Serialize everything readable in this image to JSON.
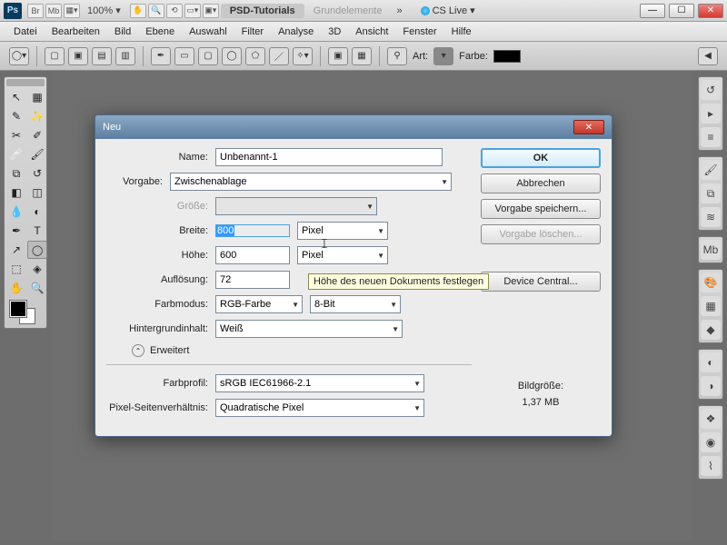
{
  "titlebar": {
    "zoom": "100%",
    "tab_active": "PSD-Tutorials",
    "tab_inactive": "Grundelemente",
    "cs_live": "CS Live"
  },
  "menubar": [
    "Datei",
    "Bearbeiten",
    "Bild",
    "Ebene",
    "Auswahl",
    "Filter",
    "Analyse",
    "3D",
    "Ansicht",
    "Fenster",
    "Hilfe"
  ],
  "optionsbar": {
    "art_label": "Art:",
    "farbe_label": "Farbe:"
  },
  "dialog": {
    "title": "Neu",
    "name_label": "Name:",
    "name_value": "Unbenannt-1",
    "vorgabe_label": "Vorgabe:",
    "vorgabe_value": "Zwischenablage",
    "groesse_label": "Größe:",
    "breite_label": "Breite:",
    "breite_value": "800",
    "breite_unit": "Pixel",
    "hoehe_label": "Höhe:",
    "hoehe_value": "600",
    "hoehe_unit": "Pixel",
    "aufloesung_label": "Auflösung:",
    "aufloesung_value": "72",
    "farbmodus_label": "Farbmodus:",
    "farbmodus_value": "RGB-Farbe",
    "farbmodus_bits": "8-Bit",
    "hintergrund_label": "Hintergrundinhalt:",
    "hintergrund_value": "Weiß",
    "erweitert": "Erweitert",
    "farbprofil_label": "Farbprofil:",
    "farbprofil_value": "sRGB IEC61966-2.1",
    "pixelsv_label": "Pixel-Seitenverhältnis:",
    "pixelsv_value": "Quadratische Pixel",
    "ok": "OK",
    "abbrechen": "Abbrechen",
    "vorgabe_speichern": "Vorgabe speichern...",
    "vorgabe_loeschen": "Vorgabe löschen...",
    "device_central": "Device Central...",
    "bildgroesse_label": "Bildgröße:",
    "bildgroesse_value": "1,37 MB",
    "tooltip": "Höhe des neuen Dokuments festlegen"
  }
}
